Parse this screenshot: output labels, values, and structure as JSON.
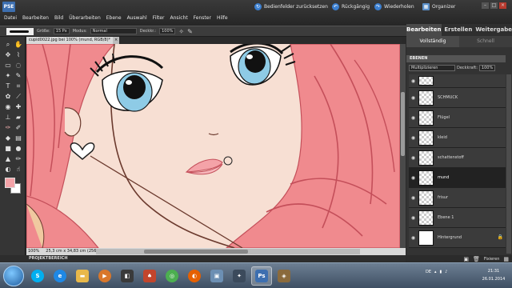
{
  "menubar": {
    "logo": "PSE",
    "items": [
      "Datei",
      "Bearbeiten",
      "Bild",
      "Überarbeiten",
      "Ebene",
      "Auswahl",
      "Filter",
      "Ansicht",
      "Fenster",
      "Hilfe"
    ],
    "reset_panels": "Bedienfelder zurücksetzen",
    "undo": "Rückgängig",
    "redo": "Wiederholen",
    "organizer": "Organizer"
  },
  "modetabs": [
    "Bearbeiten",
    "Erstellen",
    "Weitergabe"
  ],
  "options": {
    "size_label": "Größe:",
    "size_value": "15 Px",
    "mode_label": "Modus:",
    "mode_value": "Normal",
    "opacity_label": "Deckkr.:",
    "opacity_value": "100%"
  },
  "document": {
    "tab_title": "cupid0022.jpg bei 100% (mund, RGB/8)*",
    "zoom": "100%",
    "doc_info": "25,3 cm x 34,83 cm (256 ppi)",
    "project_bin": "PROJEKTBEREICH"
  },
  "panel": {
    "subtabs": [
      "Vollständig",
      "Schnell"
    ],
    "title": "EBENEN",
    "blend_mode": "Multiplizieren",
    "opacity_label": "Deckkraft:",
    "opacity_value": "100%",
    "layers": [
      "SCHMUCK",
      "Flügel",
      "kleid",
      "schattenstoff",
      "mund",
      "frisur",
      "Ebene 1",
      "Hintergrund"
    ],
    "active_layer": "mund",
    "fix_label": "Fixieren"
  },
  "taskbar": {
    "language": "DE",
    "time": "21:31",
    "date": "26.01.2014"
  },
  "colors": {
    "foreground": "#f4a3a8",
    "background": "#ffffff",
    "hair": "#f08a8e",
    "skin": "#f7dfd3",
    "eye": "#8ecbe6"
  }
}
